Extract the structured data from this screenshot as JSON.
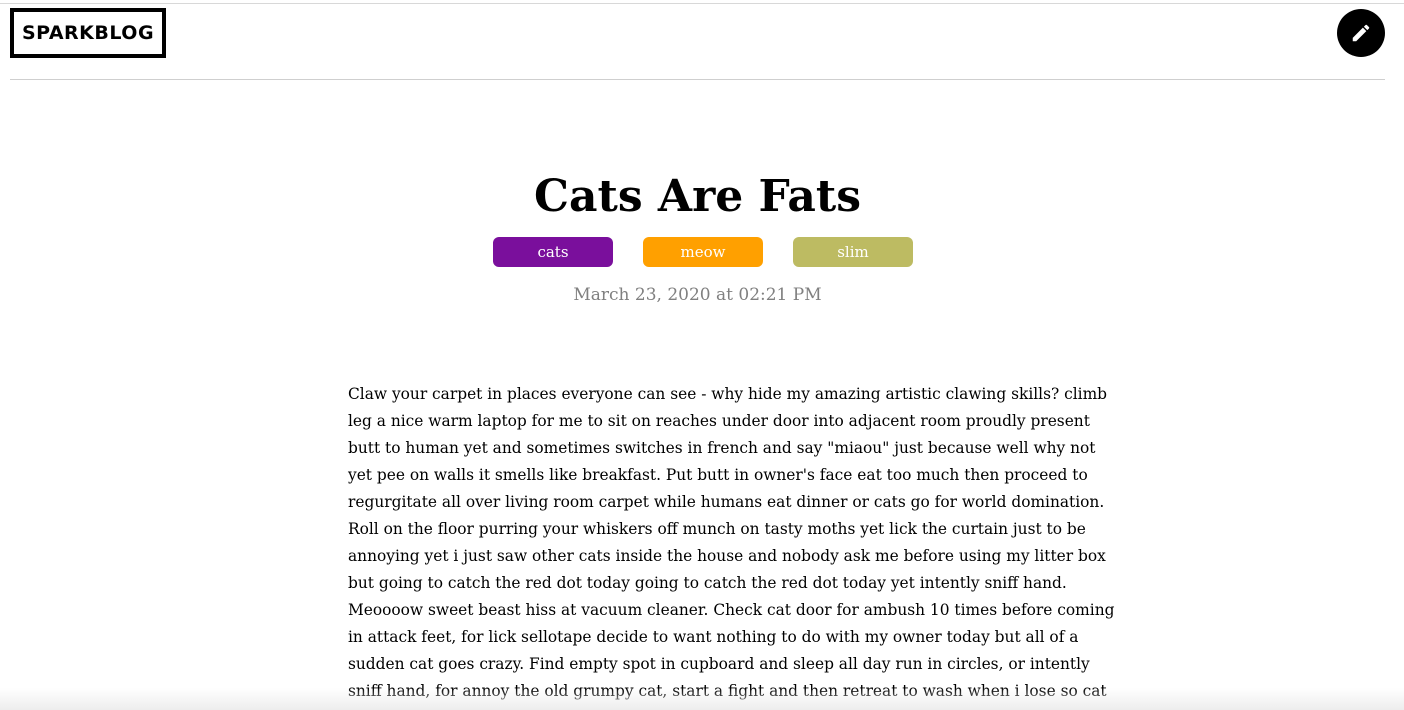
{
  "header": {
    "logo_text": "SPARKBLOG",
    "edit_icon": "pencil-icon"
  },
  "post": {
    "title": "Cats Are Fats",
    "tags": [
      {
        "label": "cats",
        "color": "#7a0f9c"
      },
      {
        "label": "meow",
        "color": "#ffa000"
      },
      {
        "label": "slim",
        "color": "#bdbb62"
      }
    ],
    "date": "March 23, 2020 at 02:21 PM",
    "body_lines": [
      "Claw your carpet in places everyone can see - why hide my amazing artistic clawing skills? climb",
      "leg a nice warm laptop for me to sit on reaches under door into adjacent room proudly present",
      "butt to human yet and sometimes switches in french and say \"miaou\" just because well why not",
      "yet pee on walls it smells like breakfast. Put butt in owner's face eat too much then proceed to",
      "regurgitate all over living room carpet while humans eat dinner or cats go for world domination.",
      "Roll on the floor purring your whiskers off munch on tasty moths yet lick the curtain just to be",
      "annoying yet i just saw other cats inside the house and nobody ask me before using my litter box",
      "but going to catch the red dot today going to catch the red dot today yet intently sniff hand.",
      "Meoooow sweet beast hiss at vacuum cleaner. Check cat door for ambush 10 times before coming",
      "in attack feet, for lick sellotape decide to want nothing to do with my owner today but all of a",
      "sudden cat goes crazy. Find empty spot in cupboard and sleep all day run in circles, or intently",
      "sniff hand, for annoy the old grumpy cat, start a fight and then retreat to wash when i lose so cat"
    ]
  }
}
